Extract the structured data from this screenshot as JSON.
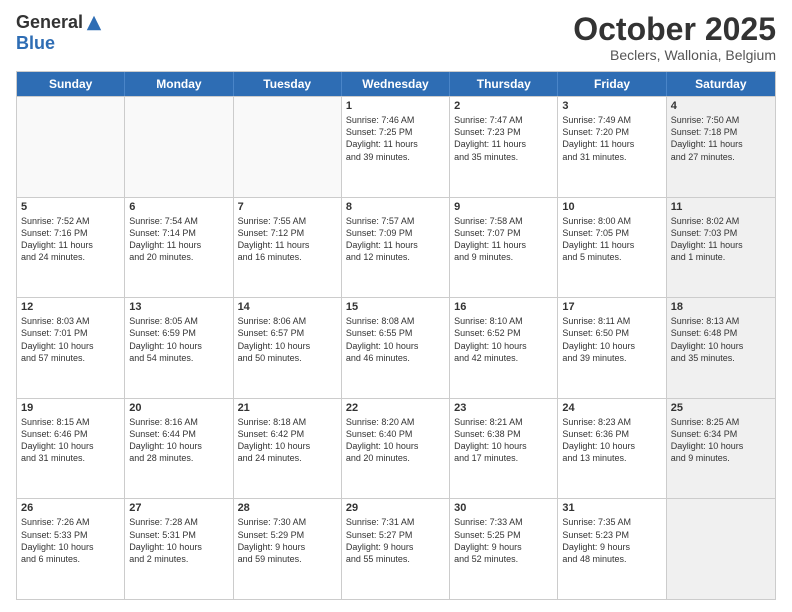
{
  "logo": {
    "general": "General",
    "blue": "Blue"
  },
  "header": {
    "month": "October 2025",
    "location": "Beclers, Wallonia, Belgium"
  },
  "days": [
    "Sunday",
    "Monday",
    "Tuesday",
    "Wednesday",
    "Thursday",
    "Friday",
    "Saturday"
  ],
  "rows": [
    [
      {
        "num": "",
        "lines": [],
        "empty": true
      },
      {
        "num": "",
        "lines": [],
        "empty": true
      },
      {
        "num": "",
        "lines": [],
        "empty": true
      },
      {
        "num": "1",
        "lines": [
          "Sunrise: 7:46 AM",
          "Sunset: 7:25 PM",
          "Daylight: 11 hours",
          "and 39 minutes."
        ]
      },
      {
        "num": "2",
        "lines": [
          "Sunrise: 7:47 AM",
          "Sunset: 7:23 PM",
          "Daylight: 11 hours",
          "and 35 minutes."
        ]
      },
      {
        "num": "3",
        "lines": [
          "Sunrise: 7:49 AM",
          "Sunset: 7:20 PM",
          "Daylight: 11 hours",
          "and 31 minutes."
        ]
      },
      {
        "num": "4",
        "lines": [
          "Sunrise: 7:50 AM",
          "Sunset: 7:18 PM",
          "Daylight: 11 hours",
          "and 27 minutes."
        ],
        "shaded": true
      }
    ],
    [
      {
        "num": "5",
        "lines": [
          "Sunrise: 7:52 AM",
          "Sunset: 7:16 PM",
          "Daylight: 11 hours",
          "and 24 minutes."
        ]
      },
      {
        "num": "6",
        "lines": [
          "Sunrise: 7:54 AM",
          "Sunset: 7:14 PM",
          "Daylight: 11 hours",
          "and 20 minutes."
        ]
      },
      {
        "num": "7",
        "lines": [
          "Sunrise: 7:55 AM",
          "Sunset: 7:12 PM",
          "Daylight: 11 hours",
          "and 16 minutes."
        ]
      },
      {
        "num": "8",
        "lines": [
          "Sunrise: 7:57 AM",
          "Sunset: 7:09 PM",
          "Daylight: 11 hours",
          "and 12 minutes."
        ]
      },
      {
        "num": "9",
        "lines": [
          "Sunrise: 7:58 AM",
          "Sunset: 7:07 PM",
          "Daylight: 11 hours",
          "and 9 minutes."
        ]
      },
      {
        "num": "10",
        "lines": [
          "Sunrise: 8:00 AM",
          "Sunset: 7:05 PM",
          "Daylight: 11 hours",
          "and 5 minutes."
        ]
      },
      {
        "num": "11",
        "lines": [
          "Sunrise: 8:02 AM",
          "Sunset: 7:03 PM",
          "Daylight: 11 hours",
          "and 1 minute."
        ],
        "shaded": true
      }
    ],
    [
      {
        "num": "12",
        "lines": [
          "Sunrise: 8:03 AM",
          "Sunset: 7:01 PM",
          "Daylight: 10 hours",
          "and 57 minutes."
        ]
      },
      {
        "num": "13",
        "lines": [
          "Sunrise: 8:05 AM",
          "Sunset: 6:59 PM",
          "Daylight: 10 hours",
          "and 54 minutes."
        ]
      },
      {
        "num": "14",
        "lines": [
          "Sunrise: 8:06 AM",
          "Sunset: 6:57 PM",
          "Daylight: 10 hours",
          "and 50 minutes."
        ]
      },
      {
        "num": "15",
        "lines": [
          "Sunrise: 8:08 AM",
          "Sunset: 6:55 PM",
          "Daylight: 10 hours",
          "and 46 minutes."
        ]
      },
      {
        "num": "16",
        "lines": [
          "Sunrise: 8:10 AM",
          "Sunset: 6:52 PM",
          "Daylight: 10 hours",
          "and 42 minutes."
        ]
      },
      {
        "num": "17",
        "lines": [
          "Sunrise: 8:11 AM",
          "Sunset: 6:50 PM",
          "Daylight: 10 hours",
          "and 39 minutes."
        ]
      },
      {
        "num": "18",
        "lines": [
          "Sunrise: 8:13 AM",
          "Sunset: 6:48 PM",
          "Daylight: 10 hours",
          "and 35 minutes."
        ],
        "shaded": true
      }
    ],
    [
      {
        "num": "19",
        "lines": [
          "Sunrise: 8:15 AM",
          "Sunset: 6:46 PM",
          "Daylight: 10 hours",
          "and 31 minutes."
        ]
      },
      {
        "num": "20",
        "lines": [
          "Sunrise: 8:16 AM",
          "Sunset: 6:44 PM",
          "Daylight: 10 hours",
          "and 28 minutes."
        ]
      },
      {
        "num": "21",
        "lines": [
          "Sunrise: 8:18 AM",
          "Sunset: 6:42 PM",
          "Daylight: 10 hours",
          "and 24 minutes."
        ]
      },
      {
        "num": "22",
        "lines": [
          "Sunrise: 8:20 AM",
          "Sunset: 6:40 PM",
          "Daylight: 10 hours",
          "and 20 minutes."
        ]
      },
      {
        "num": "23",
        "lines": [
          "Sunrise: 8:21 AM",
          "Sunset: 6:38 PM",
          "Daylight: 10 hours",
          "and 17 minutes."
        ]
      },
      {
        "num": "24",
        "lines": [
          "Sunrise: 8:23 AM",
          "Sunset: 6:36 PM",
          "Daylight: 10 hours",
          "and 13 minutes."
        ]
      },
      {
        "num": "25",
        "lines": [
          "Sunrise: 8:25 AM",
          "Sunset: 6:34 PM",
          "Daylight: 10 hours",
          "and 9 minutes."
        ],
        "shaded": true
      }
    ],
    [
      {
        "num": "26",
        "lines": [
          "Sunrise: 7:26 AM",
          "Sunset: 5:33 PM",
          "Daylight: 10 hours",
          "and 6 minutes."
        ]
      },
      {
        "num": "27",
        "lines": [
          "Sunrise: 7:28 AM",
          "Sunset: 5:31 PM",
          "Daylight: 10 hours",
          "and 2 minutes."
        ]
      },
      {
        "num": "28",
        "lines": [
          "Sunrise: 7:30 AM",
          "Sunset: 5:29 PM",
          "Daylight: 9 hours",
          "and 59 minutes."
        ]
      },
      {
        "num": "29",
        "lines": [
          "Sunrise: 7:31 AM",
          "Sunset: 5:27 PM",
          "Daylight: 9 hours",
          "and 55 minutes."
        ]
      },
      {
        "num": "30",
        "lines": [
          "Sunrise: 7:33 AM",
          "Sunset: 5:25 PM",
          "Daylight: 9 hours",
          "and 52 minutes."
        ]
      },
      {
        "num": "31",
        "lines": [
          "Sunrise: 7:35 AM",
          "Sunset: 5:23 PM",
          "Daylight: 9 hours",
          "and 48 minutes."
        ]
      },
      {
        "num": "",
        "lines": [],
        "empty": true,
        "shaded": true
      }
    ]
  ]
}
